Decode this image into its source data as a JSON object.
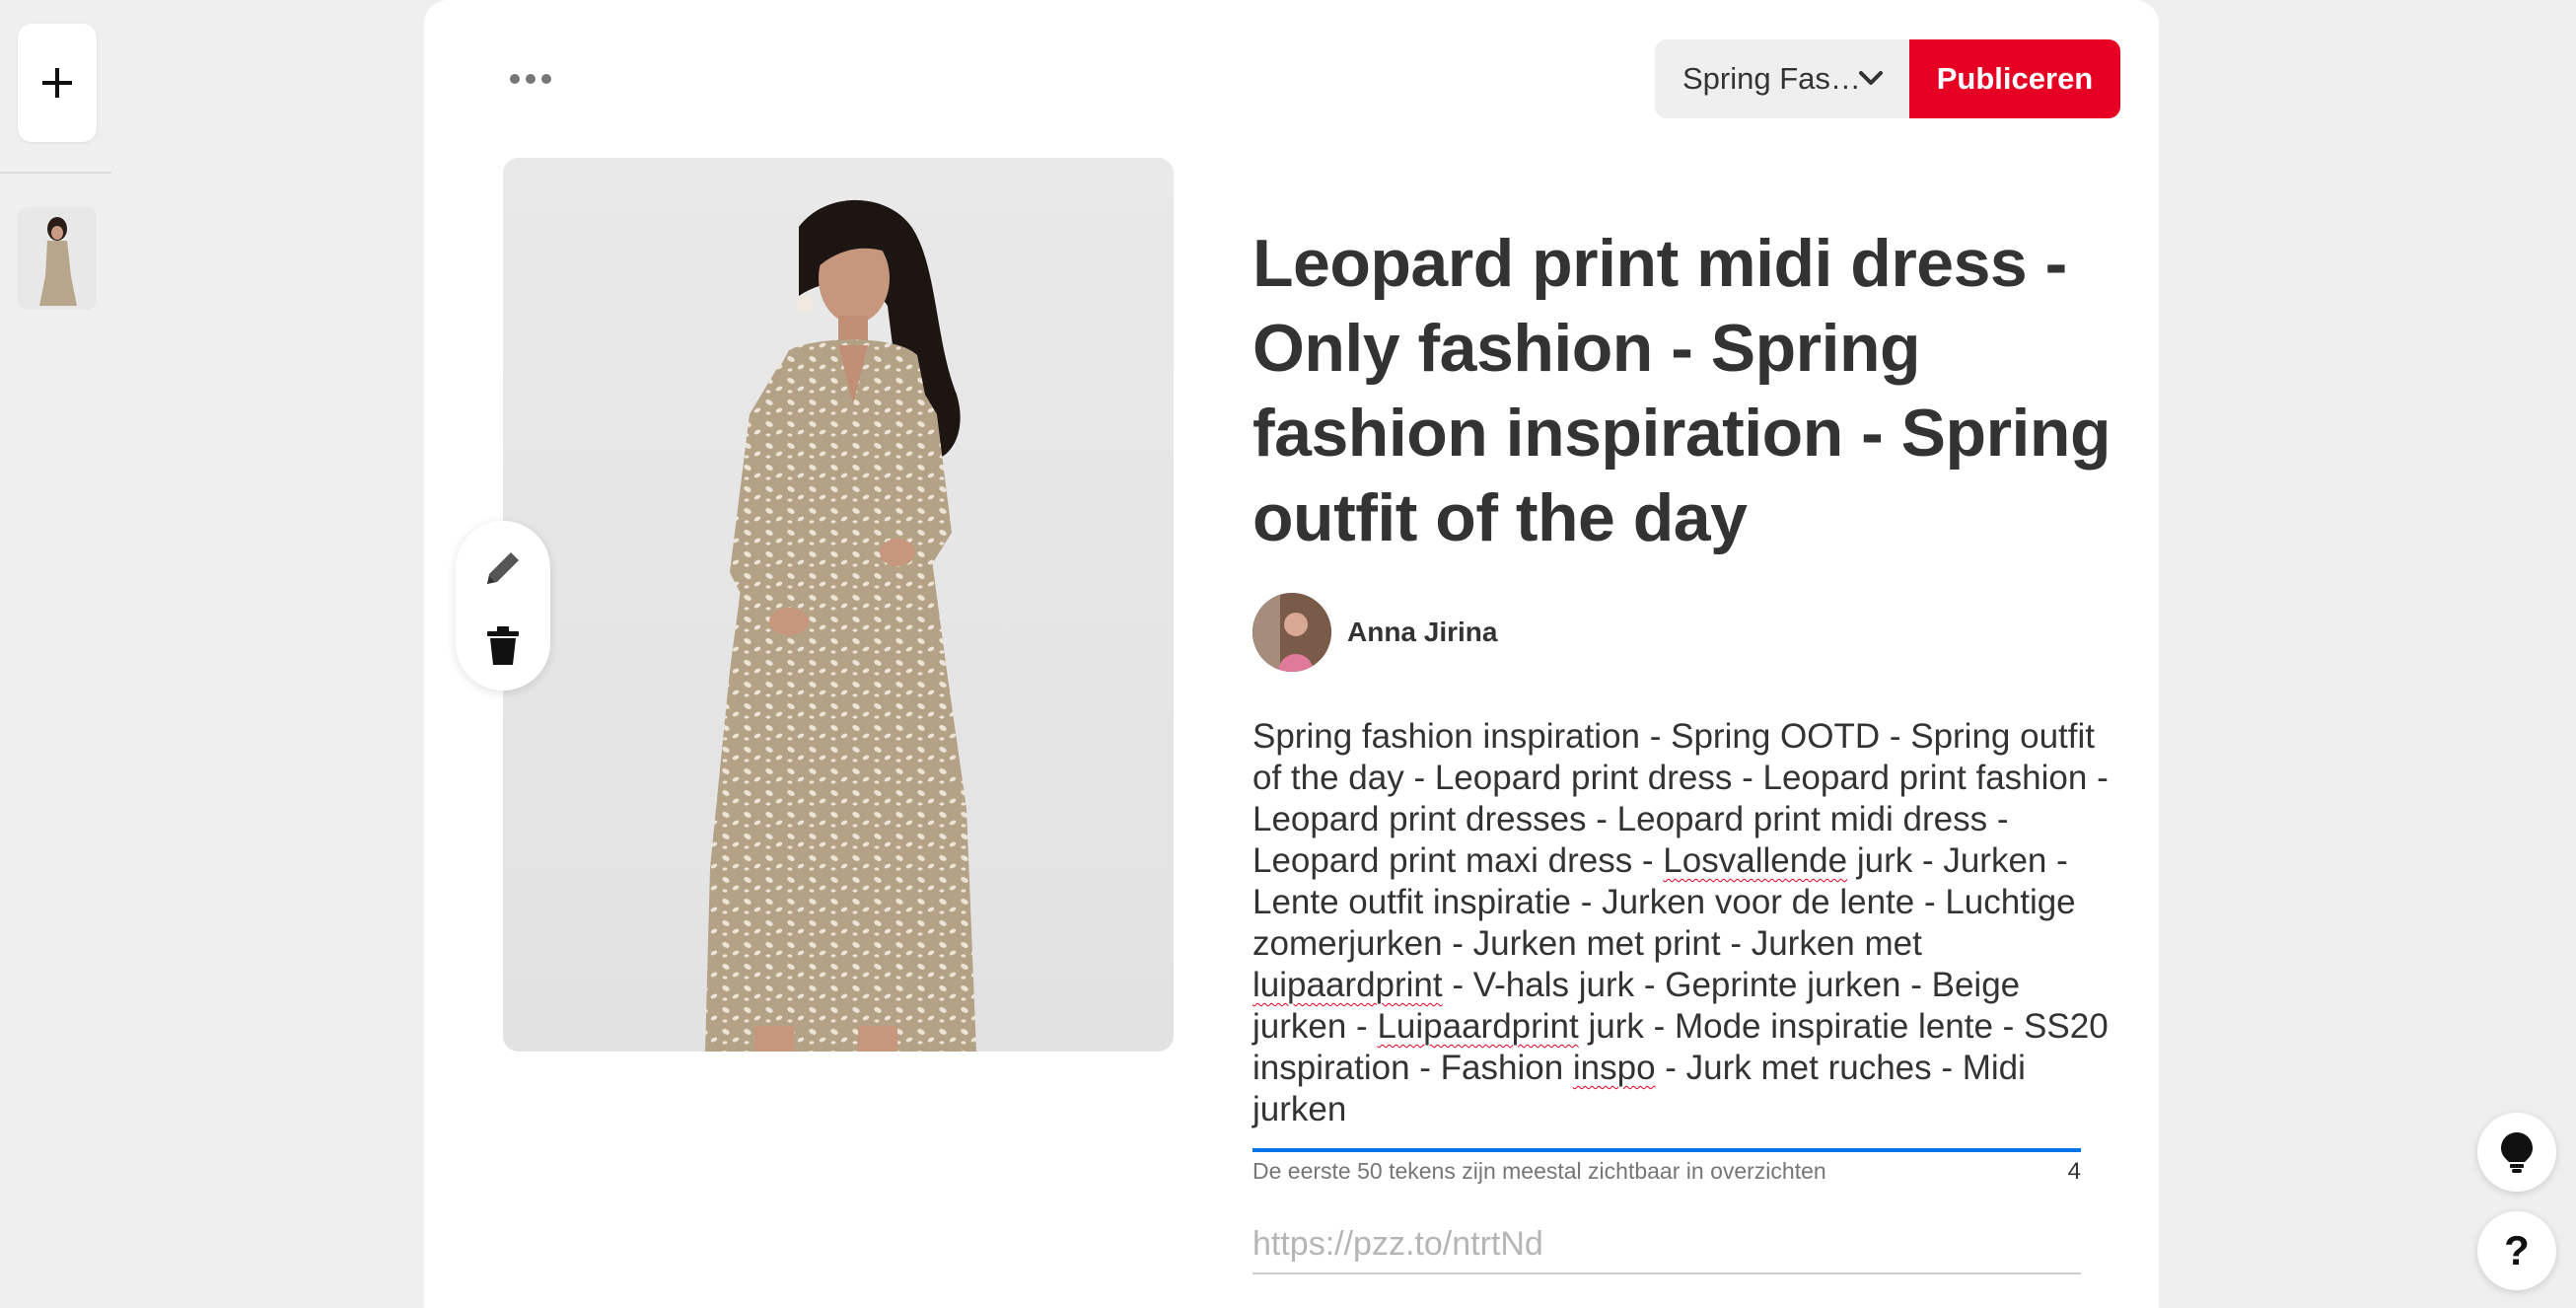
{
  "sidebar": {
    "add_label": "+",
    "thumbnail": "pin-thumbnail"
  },
  "toolbar": {
    "more_icon": "ellipsis-icon",
    "board_name": "Spring Fas…",
    "publish_label": "Publiceren"
  },
  "pin": {
    "title": "Leopard print midi dress - Only fashion - Spring fashion inspiration - Spring outfit of the day",
    "author": "Anna Jirina",
    "description_parts": [
      "Spring fashion inspiration - Spring OOTD - Spring outfit of the day - Leopard print dress - Leopard print fashion - Leopard print dresses - Leopard print midi dress - Leopard print maxi dress - ",
      "Losvallende",
      " jurk - Jurken - Lente outfit inspiratie - Jurken voor de lente - Luchtige zomerjurken - Jurken met print - Jurken met ",
      "luipaardprint",
      " - V-hals jurk - Geprinte jurken - Beige jurken - ",
      "Luipaardprint",
      " jurk - Mode inspiratie lente - SS20 inspiration - Fashion ",
      "inspo",
      " - Jurk met ruches - Midi jurken"
    ],
    "description_hint": "De eerste 50 tekens zijn meestal zichtbaar in overzichten",
    "char_counter": "4",
    "link_placeholder": "https://pzz.to/ntrtNd"
  },
  "floating": {
    "tip_icon": "lightbulb-icon",
    "help_label": "?"
  },
  "colors": {
    "accent": "#e60023",
    "focus": "#0074e8",
    "background": "#efefef"
  }
}
